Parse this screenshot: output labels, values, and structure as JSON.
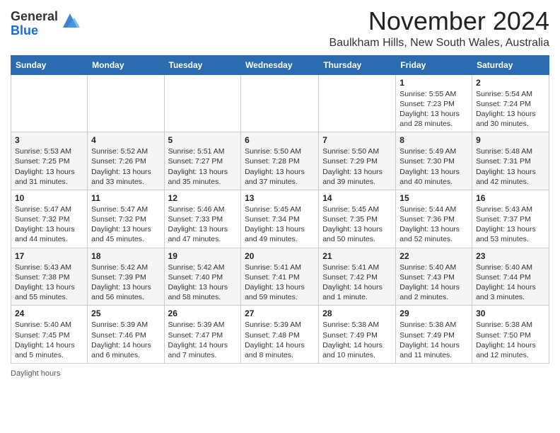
{
  "logo": {
    "general": "General",
    "blue": "Blue"
  },
  "title": "November 2024",
  "location": "Baulkham Hills, New South Wales, Australia",
  "footer": {
    "daylight_hours": "Daylight hours"
  },
  "headers": [
    "Sunday",
    "Monday",
    "Tuesday",
    "Wednesday",
    "Thursday",
    "Friday",
    "Saturday"
  ],
  "weeks": [
    [
      {
        "day": "",
        "info": ""
      },
      {
        "day": "",
        "info": ""
      },
      {
        "day": "",
        "info": ""
      },
      {
        "day": "",
        "info": ""
      },
      {
        "day": "",
        "info": ""
      },
      {
        "day": "1",
        "info": "Sunrise: 5:55 AM\nSunset: 7:23 PM\nDaylight: 13 hours and 28 minutes."
      },
      {
        "day": "2",
        "info": "Sunrise: 5:54 AM\nSunset: 7:24 PM\nDaylight: 13 hours and 30 minutes."
      }
    ],
    [
      {
        "day": "3",
        "info": "Sunrise: 5:53 AM\nSunset: 7:25 PM\nDaylight: 13 hours and 31 minutes."
      },
      {
        "day": "4",
        "info": "Sunrise: 5:52 AM\nSunset: 7:26 PM\nDaylight: 13 hours and 33 minutes."
      },
      {
        "day": "5",
        "info": "Sunrise: 5:51 AM\nSunset: 7:27 PM\nDaylight: 13 hours and 35 minutes."
      },
      {
        "day": "6",
        "info": "Sunrise: 5:50 AM\nSunset: 7:28 PM\nDaylight: 13 hours and 37 minutes."
      },
      {
        "day": "7",
        "info": "Sunrise: 5:50 AM\nSunset: 7:29 PM\nDaylight: 13 hours and 39 minutes."
      },
      {
        "day": "8",
        "info": "Sunrise: 5:49 AM\nSunset: 7:30 PM\nDaylight: 13 hours and 40 minutes."
      },
      {
        "day": "9",
        "info": "Sunrise: 5:48 AM\nSunset: 7:31 PM\nDaylight: 13 hours and 42 minutes."
      }
    ],
    [
      {
        "day": "10",
        "info": "Sunrise: 5:47 AM\nSunset: 7:32 PM\nDaylight: 13 hours and 44 minutes."
      },
      {
        "day": "11",
        "info": "Sunrise: 5:47 AM\nSunset: 7:32 PM\nDaylight: 13 hours and 45 minutes."
      },
      {
        "day": "12",
        "info": "Sunrise: 5:46 AM\nSunset: 7:33 PM\nDaylight: 13 hours and 47 minutes."
      },
      {
        "day": "13",
        "info": "Sunrise: 5:45 AM\nSunset: 7:34 PM\nDaylight: 13 hours and 49 minutes."
      },
      {
        "day": "14",
        "info": "Sunrise: 5:45 AM\nSunset: 7:35 PM\nDaylight: 13 hours and 50 minutes."
      },
      {
        "day": "15",
        "info": "Sunrise: 5:44 AM\nSunset: 7:36 PM\nDaylight: 13 hours and 52 minutes."
      },
      {
        "day": "16",
        "info": "Sunrise: 5:43 AM\nSunset: 7:37 PM\nDaylight: 13 hours and 53 minutes."
      }
    ],
    [
      {
        "day": "17",
        "info": "Sunrise: 5:43 AM\nSunset: 7:38 PM\nDaylight: 13 hours and 55 minutes."
      },
      {
        "day": "18",
        "info": "Sunrise: 5:42 AM\nSunset: 7:39 PM\nDaylight: 13 hours and 56 minutes."
      },
      {
        "day": "19",
        "info": "Sunrise: 5:42 AM\nSunset: 7:40 PM\nDaylight: 13 hours and 58 minutes."
      },
      {
        "day": "20",
        "info": "Sunrise: 5:41 AM\nSunset: 7:41 PM\nDaylight: 13 hours and 59 minutes."
      },
      {
        "day": "21",
        "info": "Sunrise: 5:41 AM\nSunset: 7:42 PM\nDaylight: 14 hours and 1 minute."
      },
      {
        "day": "22",
        "info": "Sunrise: 5:40 AM\nSunset: 7:43 PM\nDaylight: 14 hours and 2 minutes."
      },
      {
        "day": "23",
        "info": "Sunrise: 5:40 AM\nSunset: 7:44 PM\nDaylight: 14 hours and 3 minutes."
      }
    ],
    [
      {
        "day": "24",
        "info": "Sunrise: 5:40 AM\nSunset: 7:45 PM\nDaylight: 14 hours and 5 minutes."
      },
      {
        "day": "25",
        "info": "Sunrise: 5:39 AM\nSunset: 7:46 PM\nDaylight: 14 hours and 6 minutes."
      },
      {
        "day": "26",
        "info": "Sunrise: 5:39 AM\nSunset: 7:47 PM\nDaylight: 14 hours and 7 minutes."
      },
      {
        "day": "27",
        "info": "Sunrise: 5:39 AM\nSunset: 7:48 PM\nDaylight: 14 hours and 8 minutes."
      },
      {
        "day": "28",
        "info": "Sunrise: 5:38 AM\nSunset: 7:49 PM\nDaylight: 14 hours and 10 minutes."
      },
      {
        "day": "29",
        "info": "Sunrise: 5:38 AM\nSunset: 7:49 PM\nDaylight: 14 hours and 11 minutes."
      },
      {
        "day": "30",
        "info": "Sunrise: 5:38 AM\nSunset: 7:50 PM\nDaylight: 14 hours and 12 minutes."
      }
    ]
  ]
}
